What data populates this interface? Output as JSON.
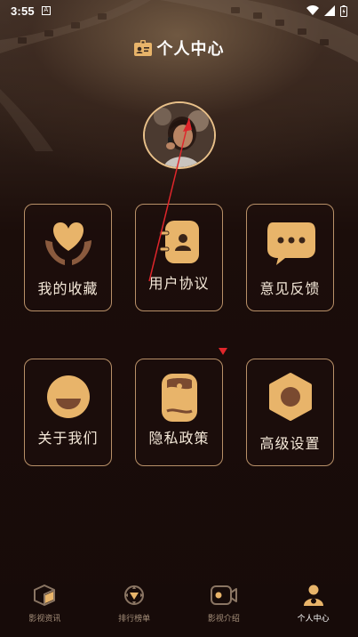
{
  "status_bar": {
    "time": "3:55",
    "notification_glyph": "A",
    "icons": [
      "wifi-icon",
      "signal-icon",
      "battery-icon"
    ]
  },
  "header": {
    "title": "个人中心",
    "icon": "id-card-icon"
  },
  "profile": {
    "avatar": "avatar-photo"
  },
  "menu": {
    "items": [
      {
        "label": "我的收藏",
        "icon": "heart-hands-icon"
      },
      {
        "label": "用户协议",
        "icon": "contact-book-icon"
      },
      {
        "label": "意见反馈",
        "icon": "chat-bubble-icon"
      },
      {
        "label": "关于我们",
        "icon": "smile-face-icon"
      },
      {
        "label": "隐私政策",
        "icon": "document-scroll-icon"
      },
      {
        "label": "高级设置",
        "icon": "hex-nut-settings-icon"
      }
    ]
  },
  "tabbar": {
    "items": [
      {
        "label": "影视资讯",
        "icon": "box-icon",
        "active": false
      },
      {
        "label": "排行榜单",
        "icon": "badge-icon",
        "active": false
      },
      {
        "label": "影视介绍",
        "icon": "camera-icon",
        "active": false
      },
      {
        "label": "个人中心",
        "icon": "user-icon",
        "active": true
      }
    ]
  },
  "colors": {
    "accent": "#e8b46a",
    "tile_border": "#b89068",
    "background": "#1a0c0a",
    "marker": "#e0262b"
  }
}
